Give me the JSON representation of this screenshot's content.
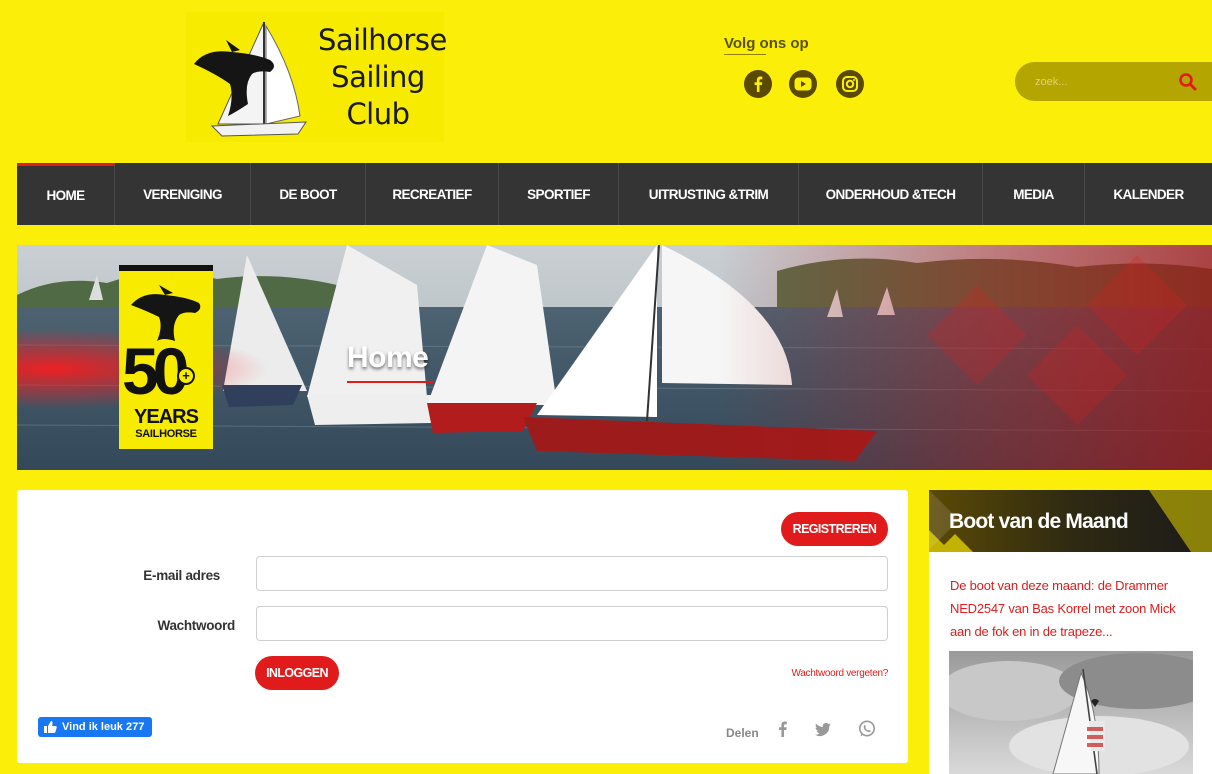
{
  "site": {
    "name_line1": "Sailhorse",
    "name_line2": "Sailing",
    "name_line3": "Club"
  },
  "social": {
    "label": "Volg ons op",
    "icons": [
      "facebook-icon",
      "youtube-icon",
      "instagram-icon"
    ]
  },
  "search": {
    "placeholder": "zoek..."
  },
  "nav": {
    "items": [
      {
        "label": "HOME",
        "active": true
      },
      {
        "label": "VERENIGING"
      },
      {
        "label": "DE BOOT"
      },
      {
        "label": "RECREATIEF"
      },
      {
        "label": "SPORTIEF"
      },
      {
        "label": "UITRUSTING &TRIM"
      },
      {
        "label": "ONDERHOUD &TECH"
      },
      {
        "label": "MEDIA"
      },
      {
        "label": "KALENDER"
      }
    ]
  },
  "hero": {
    "title": "Home",
    "badge_number": "50",
    "badge_plus": "+",
    "badge_years": "YEARS",
    "badge_brand": "SAILHORSE"
  },
  "login": {
    "register_label": "REGISTREREN",
    "email_label": "E-mail adres",
    "email_value": "",
    "password_label": "Wachtwoord",
    "password_value": "",
    "login_label": "INLOGGEN",
    "forgot_label": "Wachtwoord vergeten?"
  },
  "facebook": {
    "like_label": "Vind ik leuk 277"
  },
  "share": {
    "label": "Delen",
    "icons": [
      "facebook-icon",
      "twitter-icon",
      "whatsapp-icon"
    ]
  },
  "sidebar": {
    "title": "Boot van de Maand",
    "text": "De boot van deze maand: de Drammer NED2547 van Bas Korrel met zoon Mick aan de fok en in de trapeze..."
  },
  "colors": {
    "background": "#fbef0a",
    "nav": "#343434",
    "accent": "#e11b1b"
  }
}
